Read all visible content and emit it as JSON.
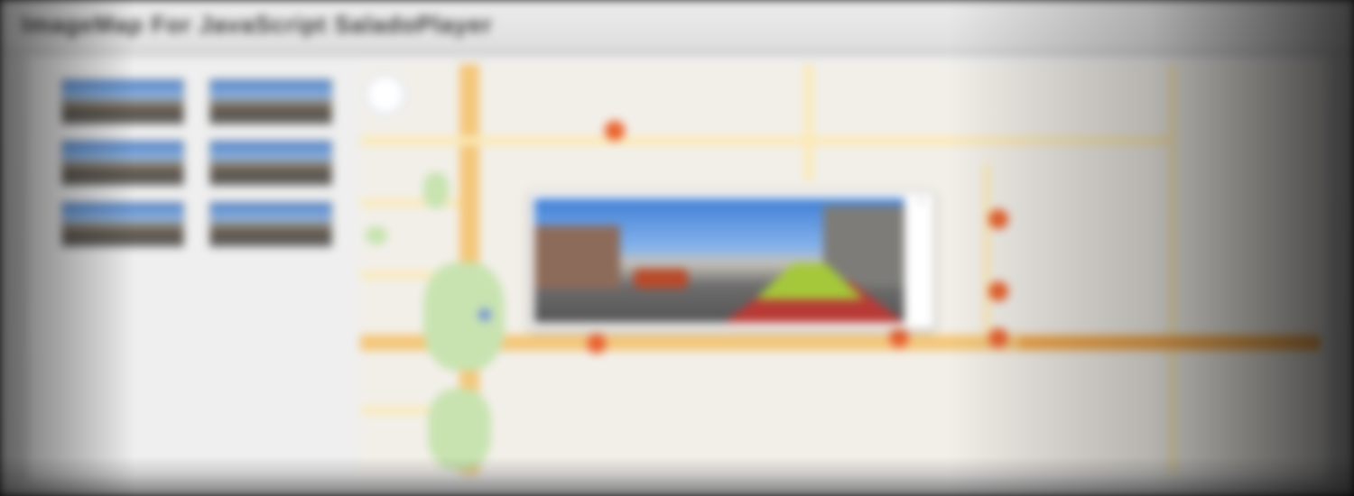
{
  "window": {
    "title": "ImageMap For JavaScript SaladoPlayer"
  },
  "thumbnails": [
    {
      "icon": "panorama-thumbnail-icon"
    },
    {
      "icon": "panorama-thumbnail-icon"
    },
    {
      "icon": "panorama-thumbnail-icon"
    },
    {
      "icon": "panorama-thumbnail-icon"
    },
    {
      "icon": "panorama-thumbnail-icon"
    },
    {
      "icon": "panorama-thumbnail-icon"
    }
  ],
  "map": {
    "markers": 7,
    "popup": {
      "close_label": "×"
    }
  },
  "colors": {
    "map_background": "#f2efe9",
    "marker": "#e8622e",
    "road_main": "#f4c77a",
    "road_highway": "#f0a64d",
    "park": "#c8e3b0"
  }
}
